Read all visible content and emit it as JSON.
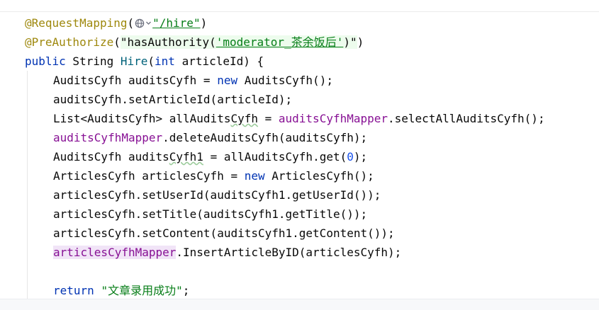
{
  "code": {
    "l1": {
      "ann": "@RequestMapping",
      "p1": "(",
      "path": "\"/hire\"",
      "p2": ")"
    },
    "l2": {
      "ann": "@PreAuthorize",
      "p1": "(",
      "s1": "\"hasAuthority(",
      "s2": "'moderator_茶余饭后'",
      "s3": ")\"",
      "p2": ")"
    },
    "l3": {
      "kw": "public",
      "t1": " String ",
      "fn": "Hire",
      "t2": "(",
      "kw2": "int",
      "t3": " articleId) {"
    },
    "l4": {
      "t1": "AuditsCyfh auditsCyfh = ",
      "kw": "new",
      "t2": " AuditsCyfh();"
    },
    "l5": {
      "t1": "auditsCyfh.setArticleId(articleId);"
    },
    "l6": {
      "t1": "List<AuditsCyfh> allAudits",
      "typo": "Cyfh",
      "t2": " = ",
      "fld": "auditsCyfhMapper",
      "t3": ".selectAllAuditsCyfh();"
    },
    "l7": {
      "fld": "auditsCyfhMapper",
      "t1": ".deleteAuditsCyfh(auditsCyfh);"
    },
    "l8": {
      "t1": "AuditsCyfh audits",
      "typo": "Cyfh1",
      "t2": " = allAuditsCyfh.get(",
      "num": "0",
      "t3": ");"
    },
    "l9": {
      "t1": "ArticlesCyfh articlesCyfh = ",
      "kw": "new",
      "t2": " ArticlesCyfh();"
    },
    "l10": {
      "t1": "articlesCyfh.setUserId(auditsCyfh1.getUserId());"
    },
    "l11": {
      "t1": "articlesCyfh.setTitle(auditsCyfh1.getTitle());"
    },
    "l12": {
      "t1": "articlesCyfh.setContent(auditsCyfh1.getContent());"
    },
    "l13": {
      "fld": "articlesCyfhMapper",
      "t1": ".InsertArticleByID(articlesCyfh);"
    },
    "l14": {
      "kw": "return",
      "t1": " ",
      "str": "\"文章录用成功\"",
      "t2": ";"
    }
  },
  "icons": {
    "inlay": "globe-icon",
    "inlay_arrow": "chevron-down-icon"
  },
  "colors": {
    "annotation": "#9e880d",
    "keyword": "#0033b3",
    "method": "#00627a",
    "string": "#067d17",
    "field": "#871094",
    "number": "#1750eb"
  }
}
